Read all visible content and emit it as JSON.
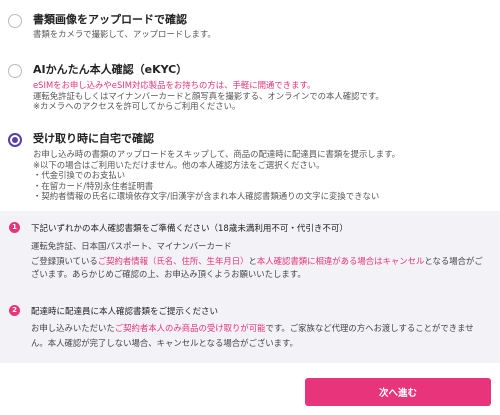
{
  "options": [
    {
      "title": "書類画像をアップロードで確認",
      "desc_lines": [
        "書類をカメラで撮影して、アップロードします。"
      ],
      "selected": false
    },
    {
      "title": "AIかんたん本人確認（eKYC）",
      "highlight": "eSIMをお申し込みやeSIM対応製品をお持ちの方は、手軽に開通できます。",
      "desc_lines": [
        "運転免許証もしくはマイナンバーカードと顔写真を撮影する、オンラインでの本人確認です。",
        "※カメラへのアクセスを許可してからご利用ください。"
      ],
      "selected": false
    },
    {
      "title": "受け取り時に自宅で確認",
      "desc_lines": [
        "お申し込み時の書類のアップロードをスキップして、商品の配達時に配達員に書類を提示します。",
        "※以下の場合はご利用いただけません。他の本人確認方法をご選択ください。",
        "・代金引換でのお支払い",
        "・在留カード/特別永住者証明書",
        "・契約者情報の氏名に環境依存文字/旧漢字が含まれ本人確認書類通りの文字に変換できない"
      ],
      "selected": true
    }
  ],
  "info": {
    "item1": {
      "number": "1",
      "title": "下記いずれかの本人確認書類をご準備ください（18歳未満利用不可・代引き不可）",
      "documents": "運転免許証、日本国パスポート、マイナンバーカード",
      "line2_pre": "ご登録頂いている",
      "line2_pink1": "ご契約者情報（氏名、住所、生年月日）",
      "line2_mid": "と",
      "line2_pink2": "本人確認書類に相違がある場合はキャンセル",
      "line2_post": "となる場合がご",
      "line3": "ざいます。あらかじめご確認の上、お申込み頂くようお願いいたします。"
    },
    "item2": {
      "number": "2",
      "title": "配達時に配達員に本人確認書類をご提示ください",
      "line1_pre": "お申し込みいただいた",
      "line1_pink": "ご契約者本人のみ商品の受け取りが可能",
      "line1_post": "です。ご家族など代理の方へお渡しすることができませ",
      "line2": "ん。本人確認が完了しない場合、キャンセルとなる場合がございます。"
    }
  },
  "next_button_label": "次へ進む",
  "colors": {
    "accent": "#e8347a",
    "radio_selected": "#5b3fa8",
    "info_bg": "#f3f2f6"
  }
}
